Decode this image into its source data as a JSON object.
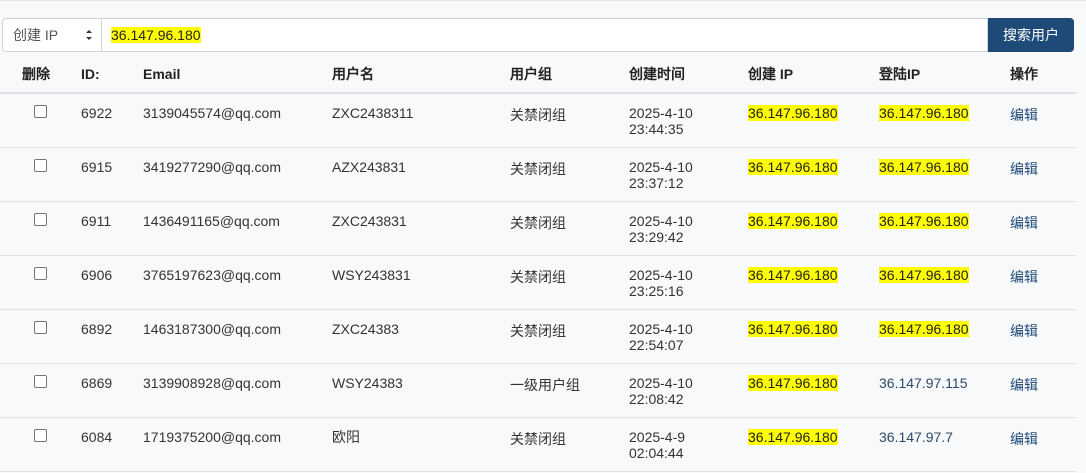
{
  "search": {
    "select_value": "创建 IP",
    "input_value": "36.147.96.180",
    "button_label": "搜索用户"
  },
  "table": {
    "headers": {
      "delete": "删除",
      "id": "ID:",
      "email": "Email",
      "username": "用户名",
      "group": "用户组",
      "created_time": "创建时间",
      "created_ip": "创建 IP",
      "login_ip": "登陆IP",
      "action": "操作"
    },
    "rows": [
      {
        "id": "6922",
        "email": "3139045574@qq.com",
        "username": "ZXC2438311",
        "group": "关禁闭组",
        "date": "2025-4-10",
        "time": "23:44:35",
        "created_ip": "36.147.96.180",
        "login_ip": "36.147.96.180",
        "edit": "编辑"
      },
      {
        "id": "6915",
        "email": "3419277290@qq.com",
        "username": "AZX243831",
        "group": "关禁闭组",
        "date": "2025-4-10",
        "time": "23:37:12",
        "created_ip": "36.147.96.180",
        "login_ip": "36.147.96.180",
        "edit": "编辑"
      },
      {
        "id": "6911",
        "email": "1436491165@qq.com",
        "username": "ZXC243831",
        "group": "关禁闭组",
        "date": "2025-4-10",
        "time": "23:29:42",
        "created_ip": "36.147.96.180",
        "login_ip": "36.147.96.180",
        "edit": "编辑"
      },
      {
        "id": "6906",
        "email": "3765197623@qq.com",
        "username": "WSY243831",
        "group": "关禁闭组",
        "date": "2025-4-10",
        "time": "23:25:16",
        "created_ip": "36.147.96.180",
        "login_ip": "36.147.96.180",
        "edit": "编辑"
      },
      {
        "id": "6892",
        "email": "1463187300@qq.com",
        "username": "ZXC24383",
        "group": "关禁闭组",
        "date": "2025-4-10",
        "time": "22:54:07",
        "created_ip": "36.147.96.180",
        "login_ip": "36.147.96.180",
        "edit": "编辑"
      },
      {
        "id": "6869",
        "email": "3139908928@qq.com",
        "username": "WSY24383",
        "group": "一级用户组",
        "date": "2025-4-10",
        "time": "22:08:42",
        "created_ip": "36.147.96.180",
        "login_ip": "36.147.97.115",
        "edit": "编辑"
      },
      {
        "id": "6084",
        "email": "1719375200@qq.com",
        "username": "欧阳",
        "group": "关禁闭组",
        "date": "2025-4-9",
        "time": "02:04:44",
        "created_ip": "36.147.96.180",
        "login_ip": "36.147.97.7",
        "edit": "编辑"
      }
    ]
  },
  "highlight_value": "36.147.96.180",
  "colors": {
    "accent": "#1e4a78",
    "highlight": "#ffff00",
    "background": "#f8f9fa"
  }
}
